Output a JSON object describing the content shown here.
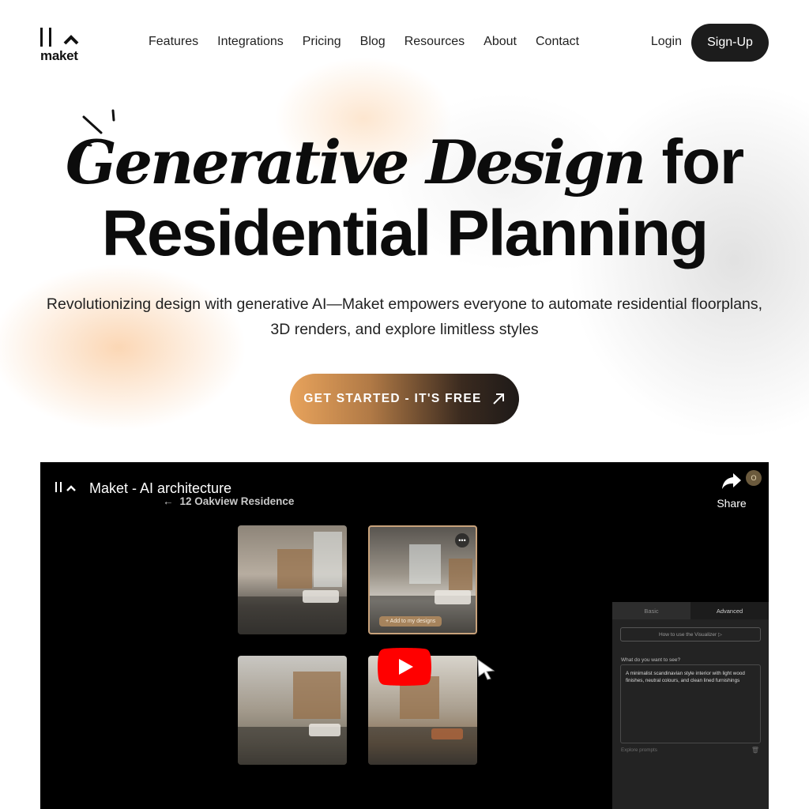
{
  "brand": {
    "logo_text": "maket"
  },
  "nav": {
    "items": [
      {
        "label": "Features"
      },
      {
        "label": "Integrations"
      },
      {
        "label": "Pricing"
      },
      {
        "label": "Blog"
      },
      {
        "label": "Resources"
      },
      {
        "label": "About"
      },
      {
        "label": "Contact"
      }
    ],
    "login_label": "Login",
    "signup_label": "Sign-Up"
  },
  "hero": {
    "title_italic": "Generative Design",
    "title_rest_line1": "for",
    "title_line2": "Residential Planning",
    "subtitle_line1": "Revolutionizing design with generative AI—Maket empowers everyone to automate residential floorplans,",
    "subtitle_line2": "3D renders, and explore limitless styles",
    "cta_label": "GET STARTED - IT'S FREE",
    "cta_icon": "arrow-up-right-icon"
  },
  "video": {
    "title": "Maket - AI architecture",
    "project_name": "12 Oakview Residence",
    "back_icon": "←",
    "share_label": "Share",
    "avatar_initial": "O",
    "more_icon": "•••",
    "add_to_designs_label": "+ Add to my designs",
    "panel": {
      "tab_basic": "Basic",
      "tab_advanced": "Advanced",
      "howto_label": "How to use the Visualizer ▷",
      "question_label": "What do you want to see?",
      "prompt_text": "A minimalist scandinavian style interior with light wood finishes, neutral colours, and clean lined furnishings",
      "explore_label": "Explore prompts",
      "trash_icon": "🗑"
    }
  },
  "colors": {
    "signup_bg": "#1c1c1c",
    "cta_gradient_start": "#e8a35c",
    "cta_gradient_end": "#1e1a18",
    "youtube_red": "#ff0000",
    "selected_thumb_border": "#c8a27b"
  }
}
